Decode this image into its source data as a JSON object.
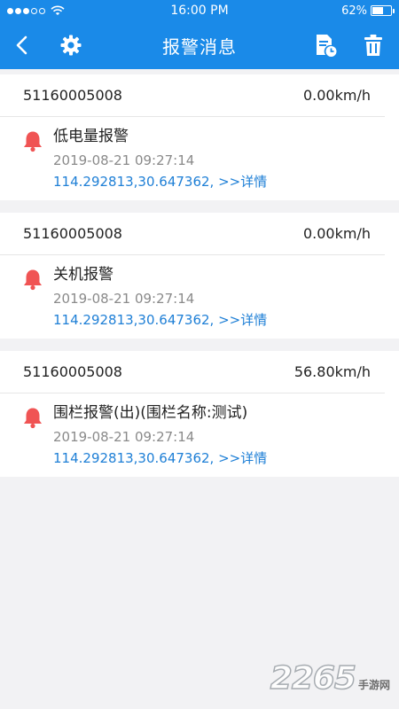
{
  "status_bar": {
    "time": "16:00 PM",
    "battery": "62%",
    "battery_level": 0.62,
    "signal_dots_filled": 3,
    "signal_dots_total": 5
  },
  "header": {
    "title": "报警消息",
    "back_icon": "chevron-left-icon",
    "settings_icon": "gear-icon",
    "report_icon": "document-clock-icon",
    "delete_icon": "trash-icon"
  },
  "colors": {
    "primary": "#1a8ae8",
    "alert_bell": "#f05454",
    "link": "#1e7fd6"
  },
  "alarms": [
    {
      "device_id": "51160005008",
      "speed": "0.00km/h",
      "title": "低电量报警",
      "time": "2019-08-21 09:27:14",
      "location": "114.292813,30.647362, >>详情"
    },
    {
      "device_id": "51160005008",
      "speed": "0.00km/h",
      "title": "关机报警",
      "time": "2019-08-21 09:27:14",
      "location": "114.292813,30.647362, >>详情"
    },
    {
      "device_id": "51160005008",
      "speed": "56.80km/h",
      "title": "围栏报警(出)(围栏名称:测试)",
      "time": "2019-08-21 09:27:14",
      "location": "114.292813,30.647362, >>详情"
    }
  ],
  "watermark": {
    "number": "2265",
    "text": "手游网"
  }
}
